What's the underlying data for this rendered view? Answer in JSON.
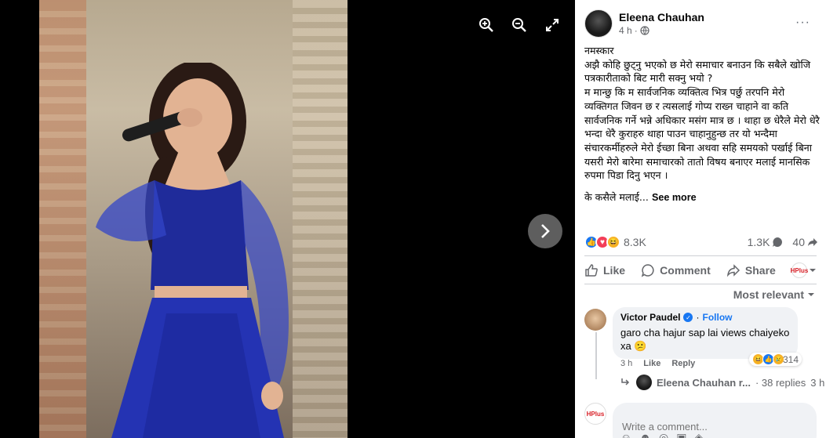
{
  "viewer": {
    "zoom_in_icon": "magnifier-plus-icon",
    "zoom_out_icon": "magnifier-minus-icon",
    "fullscreen_icon": "expand-arrows-icon",
    "next_icon": "chevron-right-icon"
  },
  "post": {
    "author": "Eleena Chauhan",
    "time": "4 h",
    "privacy_icon": "globe-icon",
    "more_label": "···",
    "lines": [
      "नमस्कार",
      "अझै कोहि छुट्नु भएको छ मेरो समाचार बनाउन कि सबैले खोजि पत्रकारीताको बिट मारी सक्नु भयो ?",
      "म मान्छु कि म सार्वजनिक व्यक्तित्व भित्र पर्छु तरपनि मेरो व्यक्तिगत जिवन छ र त्यसलाई गोप्य राख्न चाहाने वा कति सार्वजनिक गर्ने भन्ने अधिकार मसंग मात्र छ । थाहा छ धेरैले मेरो धेरै भन्दा धेरै कुराहरु थाहा पाउन चाहानुहुन्छ तर यो भन्दैमा संचारकर्मीहरुले मेरो ईच्छा बिना अथवा सहि समयको पर्खाई बिना यसरी मेरो बारेमा समाचारको तातो विषय बनाएर मलाई मानसिक रुपमा पिडा दिनु भएन ।"
    ],
    "truncated": "के कसैले मलाई...",
    "see_more": "See more"
  },
  "stats": {
    "reactions": "8.3K",
    "comments": "1.3K",
    "shares": "40"
  },
  "actions": {
    "like": "Like",
    "comment": "Comment",
    "share": "Share"
  },
  "sort": {
    "label": "Most relevant"
  },
  "comment": {
    "name": "Victor Paudel",
    "follow": "Follow",
    "text": "garo cha hajur sap lai views chaiyeko xa 😕",
    "reaction_count": "314",
    "time": "3 h",
    "like": "Like",
    "reply": "Reply"
  },
  "replies": {
    "name": "Eleena Chauhan r...",
    "count": "· 38 replies",
    "time": "3 h"
  },
  "composer": {
    "placeholder": "Write a comment..."
  },
  "page_logo_text": "HPlus"
}
